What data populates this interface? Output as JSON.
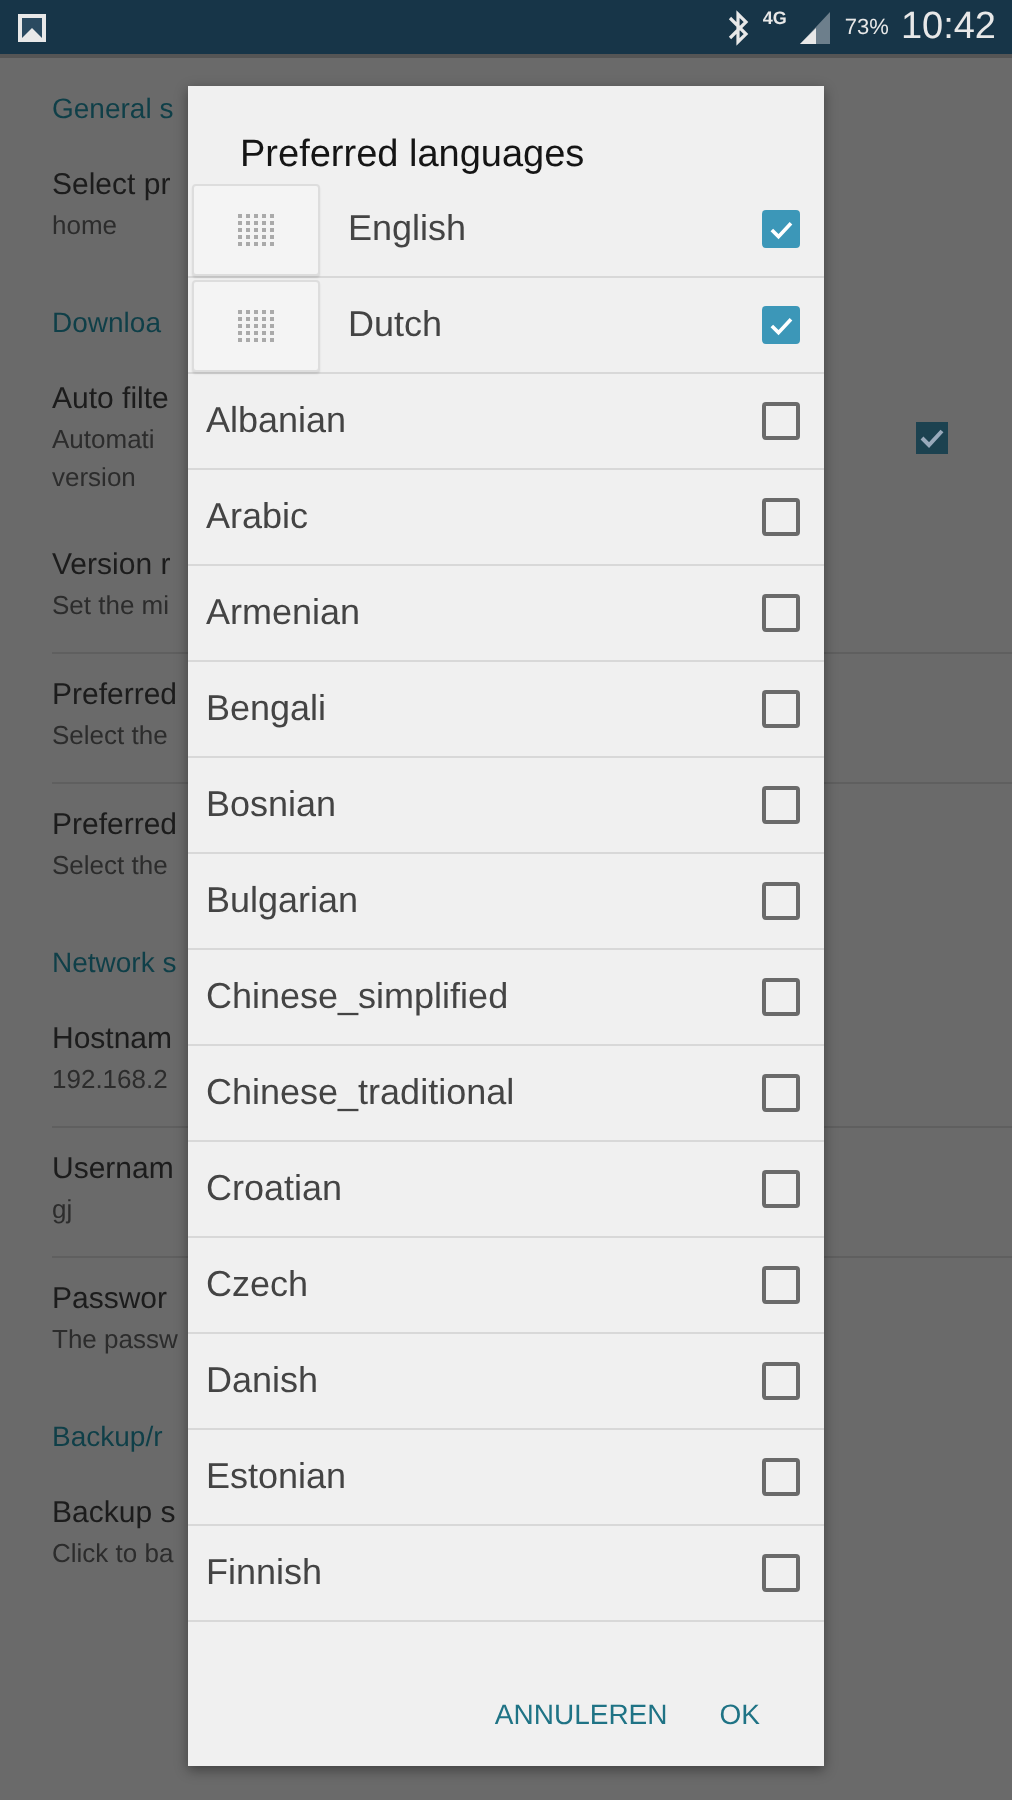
{
  "status_bar": {
    "network": "4G",
    "battery": "73%",
    "time": "10:42"
  },
  "settings": [
    {
      "header": "General s",
      "items": [
        {
          "kind": "plain",
          "title": "Select pr",
          "summary": "home"
        }
      ]
    },
    {
      "header": "Downloa",
      "items": [
        {
          "kind": "checkbox",
          "title": "Auto filte",
          "summary": "Automati\nversion",
          "checked": true
        },
        {
          "kind": "plain",
          "title": "Version r",
          "summary": "Set the mi"
        },
        {
          "kind": "plain",
          "title": "Preferred",
          "summary": "Select the"
        },
        {
          "kind": "plain",
          "title": "Preferred",
          "summary": "Select the"
        }
      ]
    },
    {
      "header": "Network s",
      "items": [
        {
          "kind": "plain",
          "title": "Hostnam",
          "summary": "192.168.2"
        },
        {
          "kind": "plain",
          "title": "Usernam",
          "summary": "gj"
        },
        {
          "kind": "plain",
          "title": "Passwor",
          "summary": "The passw"
        }
      ]
    },
    {
      "header": "Backup/r",
      "items": [
        {
          "kind": "plain",
          "title": "Backup s",
          "summary": "Click to ba"
        }
      ]
    }
  ],
  "dialog": {
    "title": "Preferred languages",
    "languages": [
      {
        "kind": "ordered",
        "name": "English",
        "checked": true
      },
      {
        "kind": "ordered",
        "name": "Dutch",
        "checked": true
      },
      {
        "kind": "plain",
        "name": "Albanian",
        "checked": false
      },
      {
        "kind": "plain",
        "name": "Arabic",
        "checked": false
      },
      {
        "kind": "plain",
        "name": "Armenian",
        "checked": false
      },
      {
        "kind": "plain",
        "name": "Bengali",
        "checked": false
      },
      {
        "kind": "plain",
        "name": "Bosnian",
        "checked": false
      },
      {
        "kind": "plain",
        "name": "Bulgarian",
        "checked": false
      },
      {
        "kind": "plain",
        "name": "Chinese_simplified",
        "checked": false
      },
      {
        "kind": "plain",
        "name": "Chinese_traditional",
        "checked": false
      },
      {
        "kind": "plain",
        "name": "Croatian",
        "checked": false
      },
      {
        "kind": "plain",
        "name": "Czech",
        "checked": false
      },
      {
        "kind": "plain",
        "name": "Danish",
        "checked": false
      },
      {
        "kind": "plain",
        "name": "Estonian",
        "checked": false
      },
      {
        "kind": "plain",
        "name": "Finnish",
        "checked": false
      }
    ],
    "buttons": [
      "ANNULEREN",
      "OK"
    ]
  }
}
